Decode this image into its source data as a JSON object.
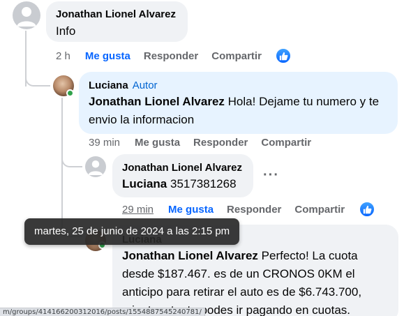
{
  "comments": [
    {
      "author": "Jonathan Lionel Alvarez",
      "text": "Info",
      "time": "2 h",
      "like_label": "Me gusta",
      "reply_label": "Responder",
      "share_label": "Compartir",
      "liked": true
    },
    {
      "author": "Luciana",
      "badge": "Autor",
      "mention": "Jonathan Lionel Alvarez",
      "text": "Hola! Dejame tu numero y te envio la informacion",
      "time": "39 min",
      "like_label": "Me gusta",
      "reply_label": "Responder",
      "share_label": "Compartir"
    },
    {
      "author": "Jonathan Lionel Alvarez",
      "mention": "Luciana",
      "text": "3517381268",
      "time": "29 min",
      "like_label": "Me gusta",
      "reply_label": "Responder",
      "share_label": "Compartir",
      "liked": true
    },
    {
      "author": "Luciana",
      "mention": "Jonathan Lionel Alvarez",
      "text": "Perfecto! La cuota desde $187.467. es de un CRONOS 0KM el anticipo para retirar el auto es de $6.743.700, mientras tanto podes ir pagando en cuotas."
    }
  ],
  "more_options": "···",
  "tooltip": "martes, 25 de junio de 2024 a las 2:15 pm",
  "status_url": "m/groups/414166200312016/posts/1554887545240781/",
  "colors": {
    "accent": "#0866ff",
    "bubble_gray": "#f0f2f5",
    "bubble_blue": "#e7f3ff",
    "online": "#31a24c"
  }
}
